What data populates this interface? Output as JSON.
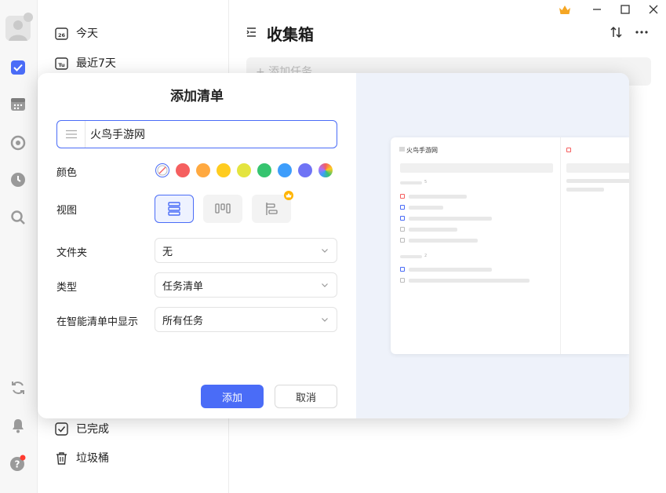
{
  "sidebar": {
    "top_items": [
      {
        "label": "今天",
        "icon": "calendar-26-icon",
        "day": "26"
      },
      {
        "label": "最近7天",
        "icon": "calendar-tu-icon",
        "day": "Tu"
      }
    ],
    "bottom_items": [
      {
        "label": "已完成",
        "icon": "checkbox-icon"
      },
      {
        "label": "垃圾桶",
        "icon": "trash-icon"
      }
    ]
  },
  "main": {
    "title": "收集箱",
    "add_task_placeholder": "+ 添加任务"
  },
  "dialog": {
    "title": "添加清单",
    "name_value": "火鸟手游网",
    "color_label": "颜色",
    "colors": [
      "none",
      "#f55f5f",
      "#ffa940",
      "#ffcc1f",
      "#e4e43f",
      "#36c46f",
      "#3d9dfb",
      "#6f73f5",
      "gradient"
    ],
    "view_label": "视图",
    "views": [
      "list-view-icon",
      "kanban-view-icon",
      "timeline-view-icon"
    ],
    "folder_label": "文件夹",
    "folder_value": "无",
    "type_label": "类型",
    "type_value": "任务清单",
    "smart_label": "在智能清单中显示",
    "smart_value": "所有任务",
    "add_button": "添加",
    "cancel_button": "取消"
  },
  "preview": {
    "title": "火鸟手游网",
    "section_counts": [
      "5",
      "2"
    ]
  },
  "colors": {
    "accent": "#4a6cf7",
    "vip": "#f5a623",
    "badge": "#ff3b30"
  }
}
